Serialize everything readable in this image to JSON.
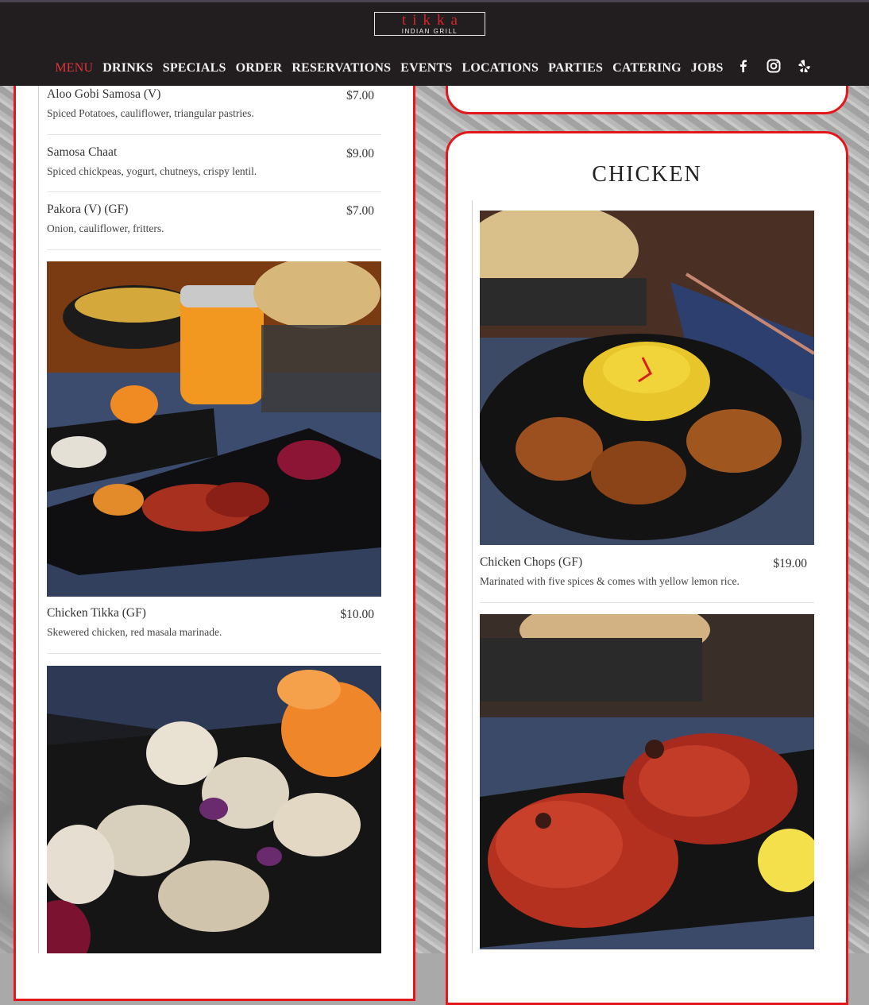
{
  "header": {
    "logo_word": "tikka",
    "logo_sub": "INDIAN GRILL",
    "nav": [
      "MENU",
      "DRINKS",
      "SPECIALS",
      "ORDER",
      "RESERVATIONS",
      "EVENTS",
      "LOCATIONS",
      "PARTIES",
      "CATERING",
      "JOBS"
    ],
    "social_icons": [
      "facebook-icon",
      "instagram-icon",
      "yelp-icon"
    ],
    "active_color": "#e0353a"
  },
  "left_items": [
    {
      "name": "Aloo Gobi Samosa (V)",
      "price": "$7.00",
      "desc": "Spiced Potatoes, cauliflower, triangular pastries."
    },
    {
      "name": "Samosa Chaat",
      "price": "$9.00",
      "desc": "Spiced chickpeas, yogurt, chutneys, crispy lentil."
    },
    {
      "name": "Pakora (V) (GF)",
      "price": "$7.00",
      "desc": "Onion, cauliflower, fritters."
    },
    {
      "name": "Chicken Tikka (GF)",
      "price": "$10.00",
      "desc": "Skewered chicken, red masala marinade."
    }
  ],
  "chicken": {
    "title": "CHICKEN",
    "items": [
      {
        "name": "Chicken Chops (GF)",
        "price": "$19.00",
        "desc": "Marinated with five spices & comes with yellow lemon rice."
      }
    ]
  },
  "accent_color": "#e3161b"
}
